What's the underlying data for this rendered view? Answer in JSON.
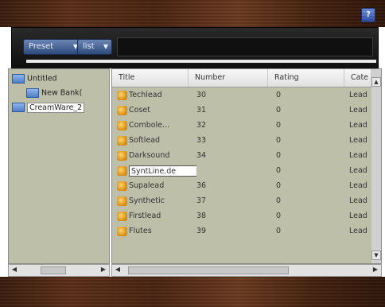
{
  "toolbar": {
    "preset_label": "Preset",
    "list_label": "list",
    "help_label": "?"
  },
  "tree": [
    {
      "label": "Untitled"
    },
    {
      "label": "New Bank("
    },
    {
      "label": "CreamWare_2"
    }
  ],
  "table": {
    "columns": [
      "Title",
      "Number",
      "Rating",
      "Cate"
    ],
    "rows": [
      {
        "title": "Techlead",
        "number": "30",
        "rating": "0",
        "category": "Lead"
      },
      {
        "title": "Coset",
        "number": "31",
        "rating": "0",
        "category": "Lead"
      },
      {
        "title": "Combole...",
        "number": "32",
        "rating": "0",
        "category": "Lead"
      },
      {
        "title": "Softlead",
        "number": "33",
        "rating": "0",
        "category": "Lead"
      },
      {
        "title": "Darksound",
        "number": "34",
        "rating": "0",
        "category": "Lead"
      },
      {
        "title": "SyntLine.de",
        "number": "",
        "rating": "0",
        "category": "Lead"
      },
      {
        "title": "Supalead",
        "number": "36",
        "rating": "0",
        "category": "Lead"
      },
      {
        "title": "Synthetic",
        "number": "37",
        "rating": "0",
        "category": "Lead"
      },
      {
        "title": "Firstlead",
        "number": "38",
        "rating": "0",
        "category": "Lead"
      },
      {
        "title": "Flutes",
        "number": "39",
        "rating": "0",
        "category": "Lead"
      }
    ]
  }
}
